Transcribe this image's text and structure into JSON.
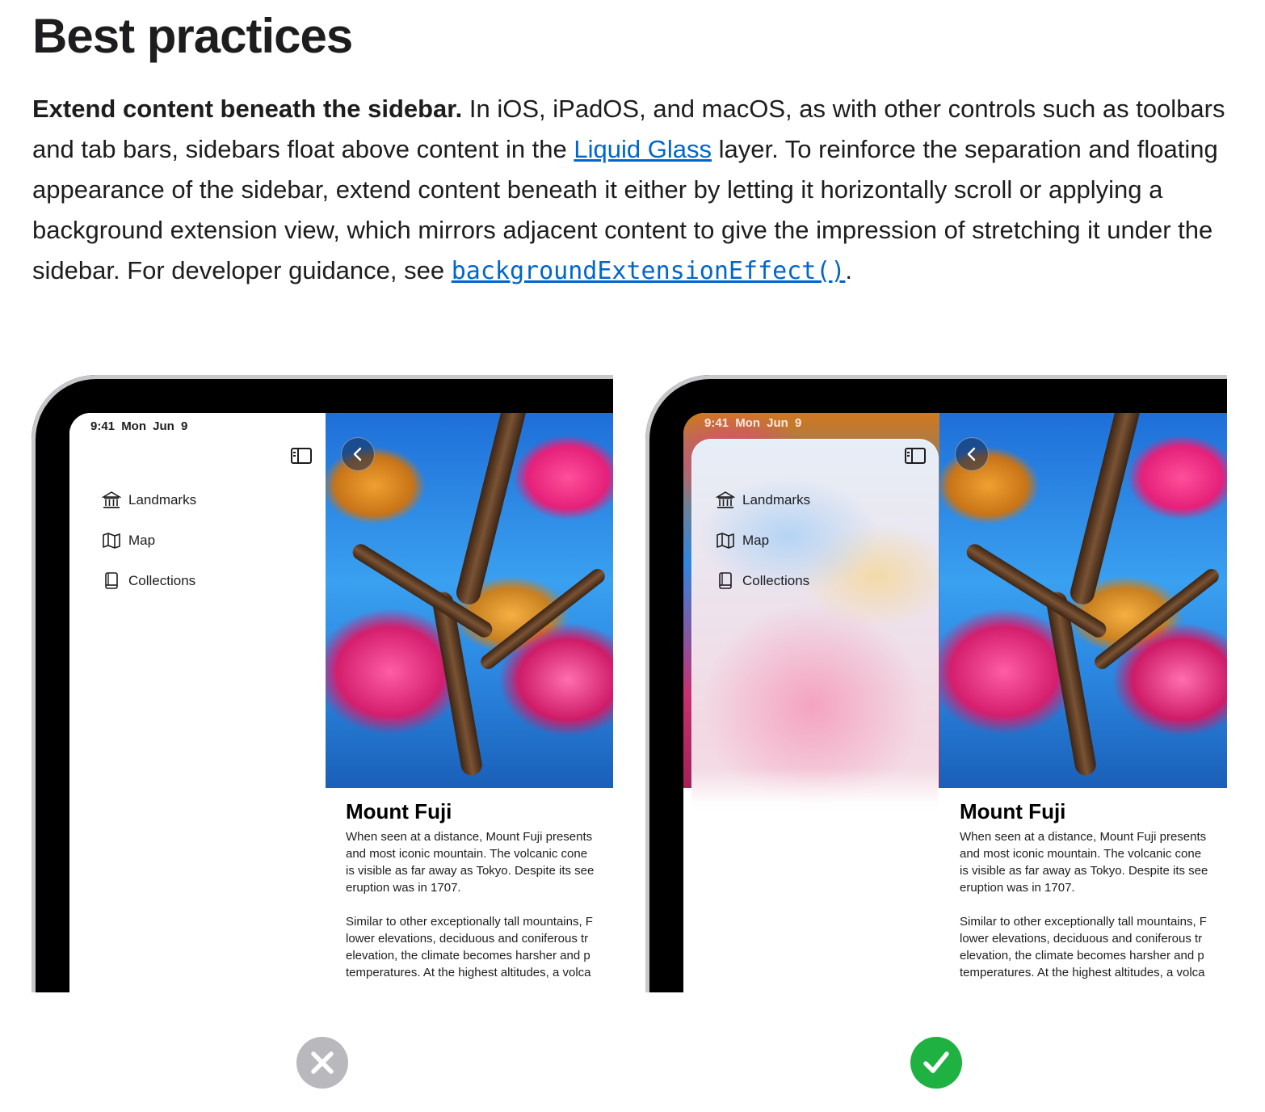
{
  "section": {
    "heading": "Best practices"
  },
  "paragraph": {
    "lead": "Extend content beneath the sidebar.",
    "text_1": " In iOS, iPadOS, and macOS, as with other controls such as toolbars and tab bars, sidebars float above content in the ",
    "link_1": "Liquid Glass",
    "text_2": " layer. To reinforce the separation and floating appearance of the sidebar, extend content beneath it either by letting it horizontally scroll or applying a background extension view, which mirrors adjacent content to give the impression of stretching it under the sidebar. For developer guidance, see ",
    "link_2": "backgroundExtensionEffect()",
    "text_3": "."
  },
  "examples": [
    {
      "verdict": "incorrect",
      "status_bar": "9:41  Mon Jun 9",
      "sidebar_items": [
        {
          "label": "Landmarks",
          "icon": "building-columns-icon"
        },
        {
          "label": "Map",
          "icon": "map-icon"
        },
        {
          "label": "Collections",
          "icon": "book-icon"
        }
      ],
      "detail_title": "Mount Fuji",
      "detail_lines_1": [
        "When seen at a distance, Mount Fuji presents",
        "and most iconic mountain. The volcanic cone",
        "is visible as far away as Tokyo. Despite its see",
        "eruption was in 1707."
      ],
      "detail_lines_2": [
        "Similar to other exceptionally tall mountains, F",
        "lower elevations, deciduous and coniferous tr",
        "elevation, the climate becomes harsher and p",
        "temperatures. At the highest altitudes, a volca"
      ],
      "badge_icon": "x-mark-icon",
      "badge_color": "#b8b8bd"
    },
    {
      "verdict": "correct",
      "status_bar": "9:41  Mon Jun 9",
      "sidebar_items": [
        {
          "label": "Landmarks",
          "icon": "building-columns-icon"
        },
        {
          "label": "Map",
          "icon": "map-icon"
        },
        {
          "label": "Collections",
          "icon": "book-icon"
        }
      ],
      "detail_title": "Mount Fuji",
      "detail_lines_1": [
        "When seen at a distance, Mount Fuji presents",
        "and most iconic mountain. The volcanic cone",
        "is visible as far away as Tokyo. Despite its see",
        "eruption was in 1707."
      ],
      "detail_lines_2": [
        "Similar to other exceptionally tall mountains, F",
        "lower elevations, deciduous and coniferous tr",
        "elevation, the climate becomes harsher and p",
        "temperatures. At the highest altitudes, a volca"
      ],
      "badge_icon": "checkmark-icon",
      "badge_color": "#1fb141"
    }
  ],
  "colors": {
    "link": "#0066cc",
    "text": "#1d1d1f"
  }
}
